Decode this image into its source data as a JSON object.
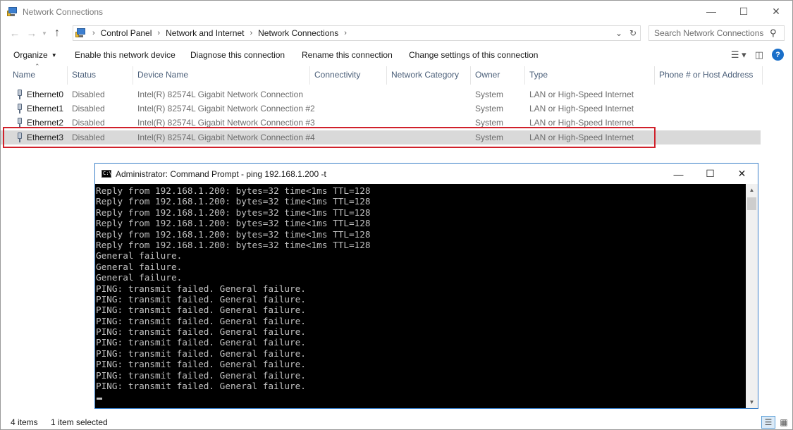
{
  "explorer": {
    "title": "Network Connections",
    "address": {
      "crumbs": [
        "Control Panel",
        "Network and Internet",
        "Network Connections"
      ]
    },
    "search_placeholder": "Search Network Connections",
    "commands": {
      "organize": "Organize",
      "enable": "Enable this network device",
      "diagnose": "Diagnose this connection",
      "rename": "Rename this connection",
      "change": "Change settings of this connection"
    },
    "columns": [
      "Name",
      "Status",
      "Device Name",
      "Connectivity",
      "Network Category",
      "Owner",
      "Type",
      "Phone # or Host Address"
    ],
    "rows": [
      {
        "name": "Ethernet0",
        "status": "Disabled",
        "device": "Intel(R) 82574L Gigabit Network Connection",
        "owner": "System",
        "type": "LAN or High-Speed Internet"
      },
      {
        "name": "Ethernet1",
        "status": "Disabled",
        "device": "Intel(R) 82574L Gigabit Network Connection #2",
        "owner": "System",
        "type": "LAN or High-Speed Internet"
      },
      {
        "name": "Ethernet2",
        "status": "Disabled",
        "device": "Intel(R) 82574L Gigabit Network Connection #3",
        "owner": "System",
        "type": "LAN or High-Speed Internet"
      },
      {
        "name": "Ethernet3",
        "status": "Disabled",
        "device": "Intel(R) 82574L Gigabit Network Connection #4",
        "owner": "System",
        "type": "LAN or High-Speed Internet"
      }
    ],
    "status": {
      "items": "4 items",
      "selected": "1 item selected"
    }
  },
  "cmd": {
    "title": "Administrator: Command Prompt - ping  192.168.1.200 -t",
    "lines": [
      "Reply from 192.168.1.200: bytes=32 time<1ms TTL=128",
      "Reply from 192.168.1.200: bytes=32 time<1ms TTL=128",
      "Reply from 192.168.1.200: bytes=32 time<1ms TTL=128",
      "Reply from 192.168.1.200: bytes=32 time<1ms TTL=128",
      "Reply from 192.168.1.200: bytes=32 time<1ms TTL=128",
      "Reply from 192.168.1.200: bytes=32 time<1ms TTL=128",
      "General failure.",
      "General failure.",
      "General failure.",
      "PING: transmit failed. General failure.",
      "PING: transmit failed. General failure.",
      "PING: transmit failed. General failure.",
      "PING: transmit failed. General failure.",
      "PING: transmit failed. General failure.",
      "PING: transmit failed. General failure.",
      "PING: transmit failed. General failure.",
      "PING: transmit failed. General failure.",
      "PING: transmit failed. General failure.",
      "PING: transmit failed. General failure."
    ]
  },
  "colors": {
    "highlight": "#d0212b",
    "selected_row": "#d9d9d9",
    "console_bg": "#000000",
    "console_text": "#c0c0c0",
    "cmd_border": "#3a7fc8"
  }
}
